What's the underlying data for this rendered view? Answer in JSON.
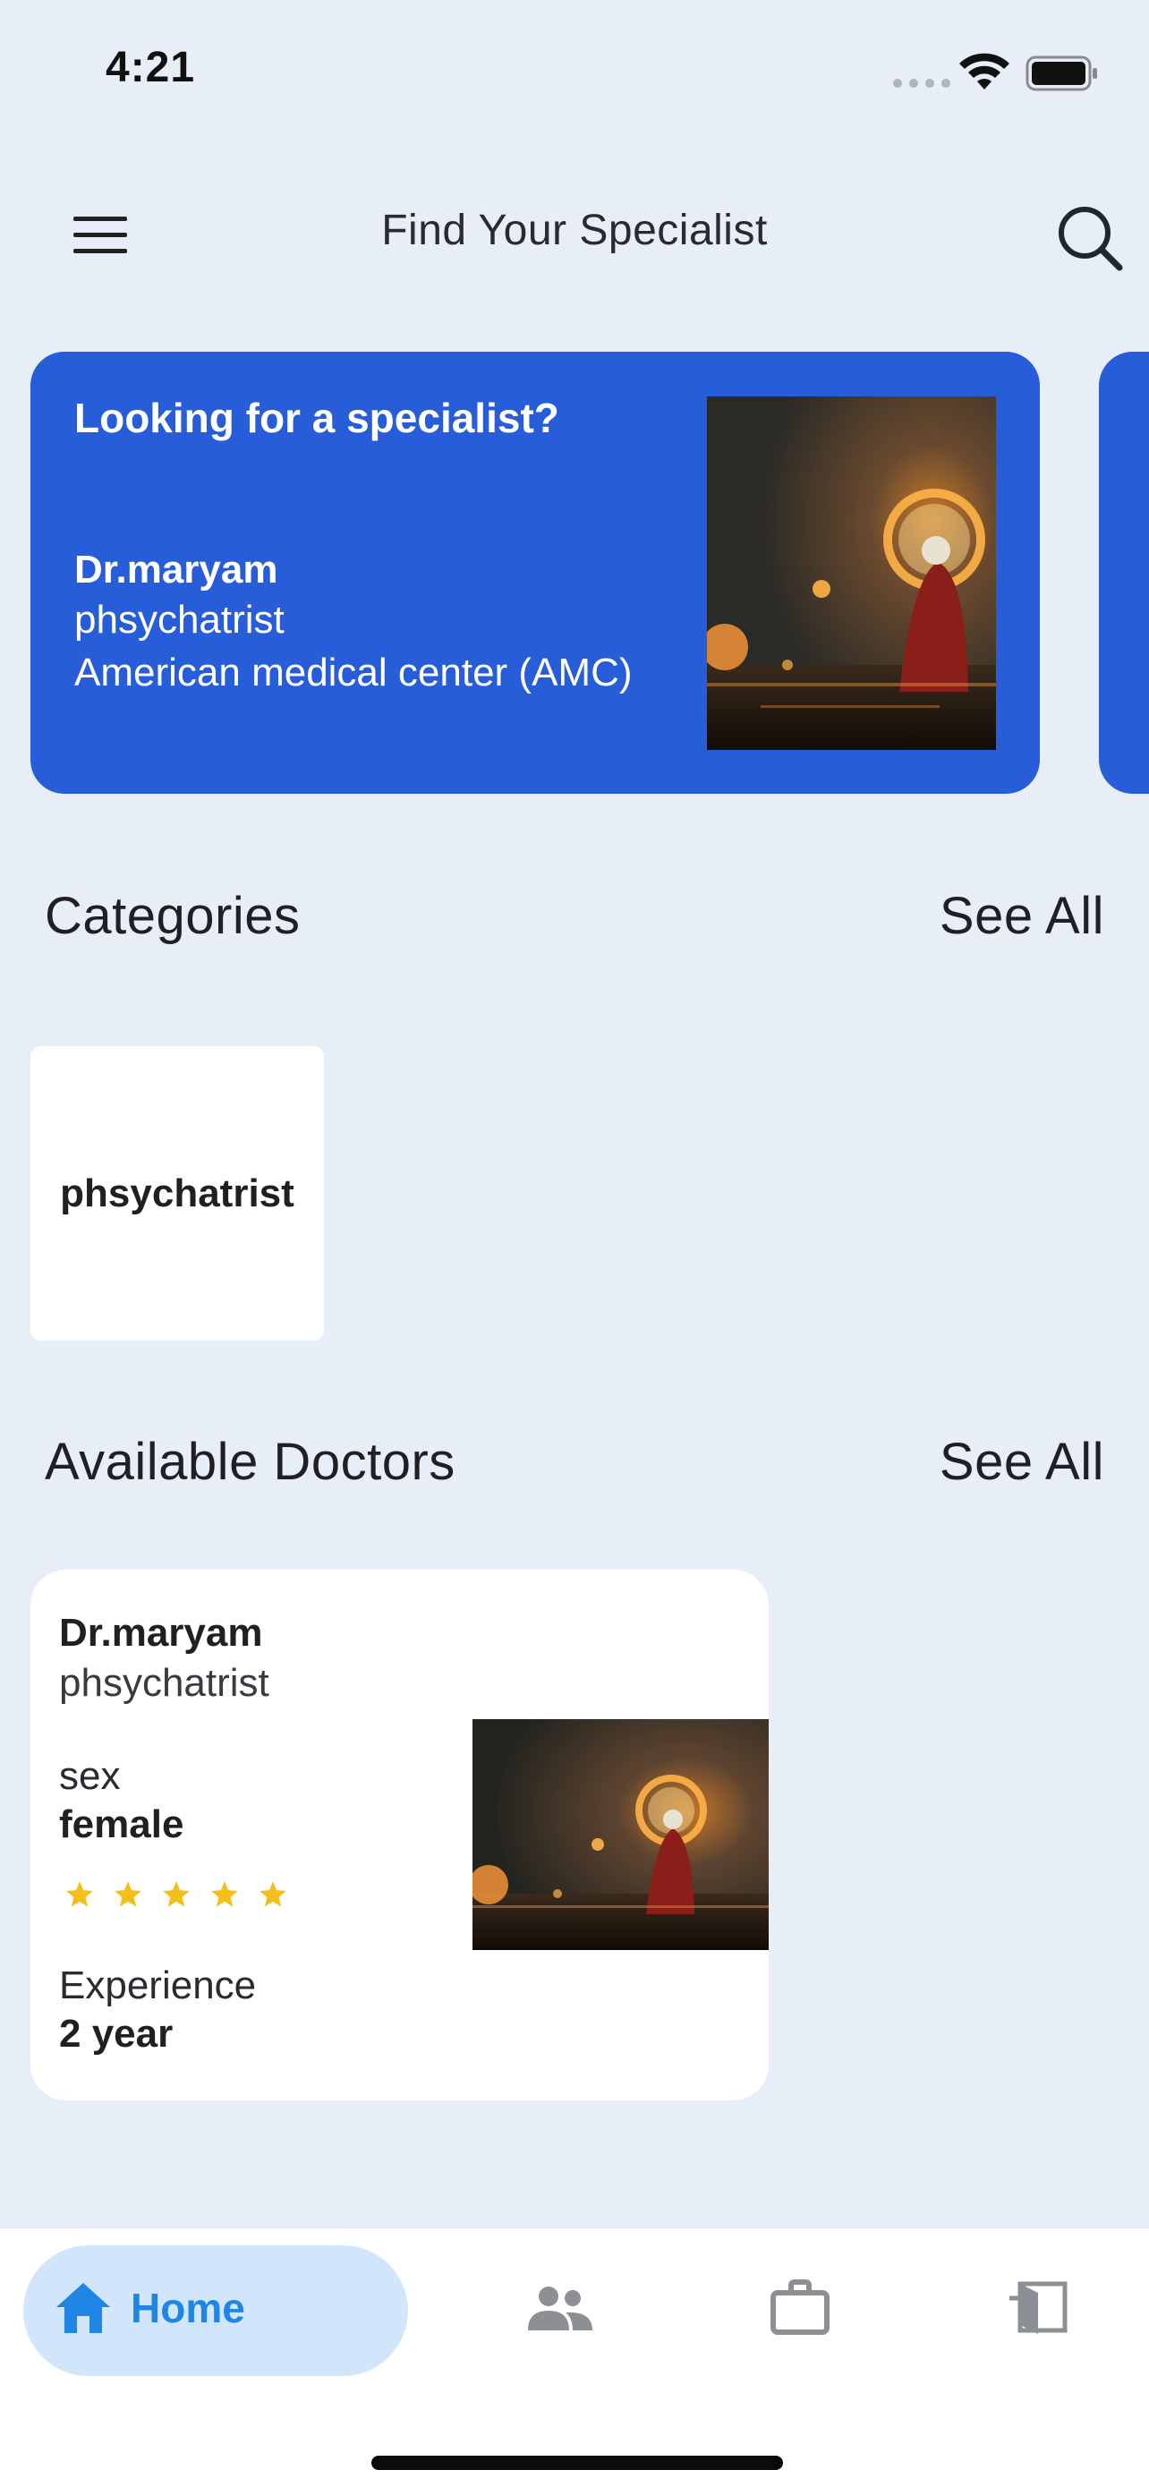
{
  "status_bar": {
    "time": "4:21"
  },
  "header": {
    "title": "Find Your Specialist",
    "menu_icon": "hamburger-menu-icon",
    "search_icon": "search-icon"
  },
  "hero": {
    "title": "Looking for a specialist?",
    "doctor_name": "Dr.maryam",
    "specialty": "phsychatrist",
    "center": "American medical center (AMC)",
    "background_color": "#285dd9"
  },
  "categories": {
    "title": "Categories",
    "see_all": "See All",
    "items": [
      {
        "label": "phsychatrist"
      }
    ]
  },
  "doctors": {
    "title": "Available Doctors",
    "see_all": "See All",
    "items": [
      {
        "name": "Dr.maryam",
        "specialty": "phsychatrist",
        "sex_label": "sex",
        "sex": "female",
        "rating": 5,
        "rating_max": 5,
        "experience_label": "Experience",
        "experience": "2 year"
      }
    ]
  },
  "bottom_nav": {
    "items": [
      {
        "label": "Home",
        "icon": "home-icon",
        "active": true
      },
      {
        "label": "",
        "icon": "people-icon",
        "active": false
      },
      {
        "label": "",
        "icon": "briefcase-icon",
        "active": false
      },
      {
        "label": "",
        "icon": "exit-icon",
        "active": false
      }
    ],
    "active_color": "#1f86e6",
    "active_pill_color": "#d2e6fb"
  },
  "colors": {
    "background": "#e8eef8",
    "star": "#f5bf1b"
  }
}
